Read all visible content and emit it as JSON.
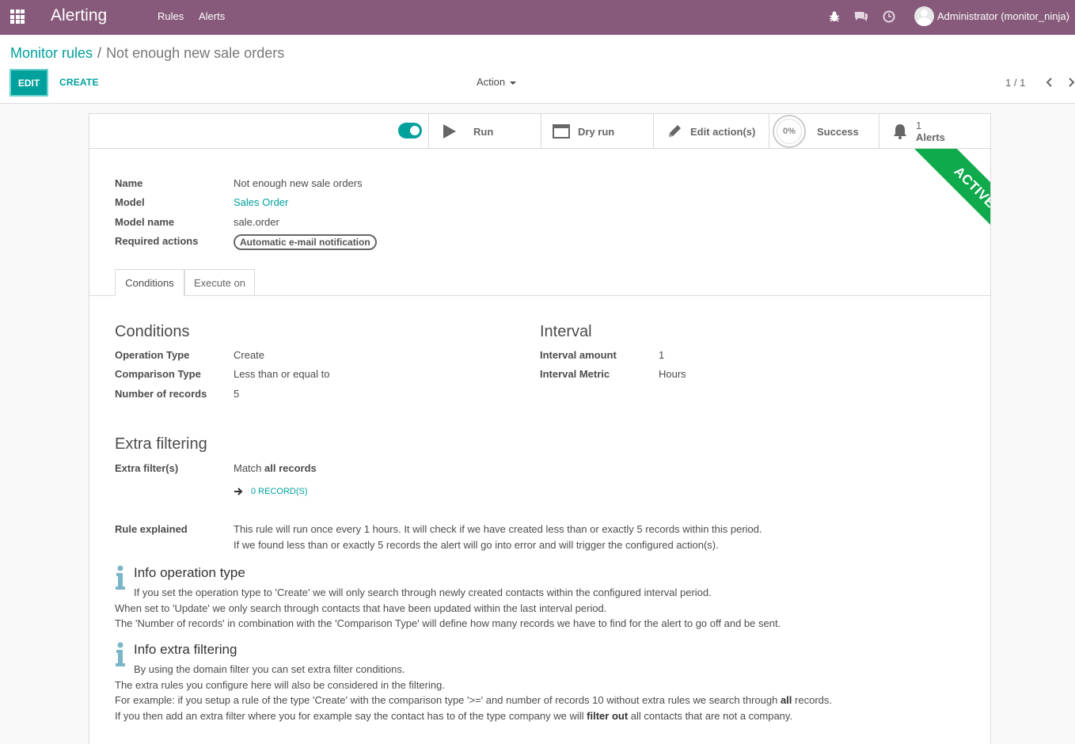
{
  "navbar": {
    "app_title": "Alerting",
    "menu": [
      "Rules",
      "Alerts"
    ],
    "user": "Administrator (monitor_ninja)"
  },
  "breadcrumb": {
    "parent": "Monitor rules",
    "separator": "/",
    "current": "Not enough new sale orders"
  },
  "toolbar": {
    "edit": "EDIT",
    "create": "CREATE",
    "action": "Action",
    "pager": "1 / 1"
  },
  "stat_buttons": {
    "run": "Run",
    "dry_run": "Dry run",
    "edit_actions": "Edit action(s)",
    "success_pct": "0%",
    "success": "Success",
    "alerts_count": "1",
    "alerts": "Alerts"
  },
  "ribbon": "ACTIVE",
  "fields": {
    "name_label": "Name",
    "name_value": "Not enough new sale orders",
    "model_label": "Model",
    "model_value": "Sales Order",
    "model_name_label": "Model name",
    "model_name_value": "sale.order",
    "required_actions_label": "Required actions",
    "required_actions_tag": "Automatic e-mail notification"
  },
  "tabs": [
    "Conditions",
    "Execute on"
  ],
  "conditions": {
    "title": "Conditions",
    "operation_type_label": "Operation Type",
    "operation_type_value": "Create",
    "comparison_type_label": "Comparison Type",
    "comparison_type_value": "Less than or equal to",
    "num_records_label": "Number of records",
    "num_records_value": "5"
  },
  "interval": {
    "title": "Interval",
    "amount_label": "Interval amount",
    "amount_value": "1",
    "metric_label": "Interval Metric",
    "metric_value": "Hours"
  },
  "extra_filtering": {
    "title": "Extra filtering",
    "label": "Extra filter(s)",
    "match_prefix": "Match",
    "match_bold": "all records",
    "records_link": "0 RECORD(S)"
  },
  "rule_explained": {
    "label": "Rule explained",
    "line1": "This rule will run once every 1 hours. It will check if we have created less than or exactly 5 records within this period.",
    "line2": "If we found less than or exactly 5 records the alert will go into error and will trigger the configured action(s)."
  },
  "info_operation": {
    "title": "Info operation type",
    "line1": "If you set the operation type to 'Create' we will only search through newly created contacts within the configured interval period.",
    "line2": "When set to 'Update' we only search through contacts that have been updated within the last interval period.",
    "line3": "The 'Number of records' in combination with the 'Comparison Type' will define how many records we have to find for the alert to go off and be sent."
  },
  "info_extra": {
    "title": "Info extra filtering",
    "line1": "By using the domain filter you can set extra filter conditions.",
    "line2": "The extra rules you configure here will also be considered in the filtering.",
    "line3a": "For example: if you setup a rule of the type 'Create' with the comparison type '>=' and number of records 10 without extra rules we search through",
    "line3b": "all",
    "line3c": "records.",
    "line4a": "If you then add an extra filter where you for example say the contact has to of the type company we will",
    "line4b": "filter out",
    "line4c": "all contacts that are not a company."
  },
  "colors": {
    "brand": "#875a7b",
    "accent": "#00a09d",
    "ribbon": "#0eaa4c"
  }
}
